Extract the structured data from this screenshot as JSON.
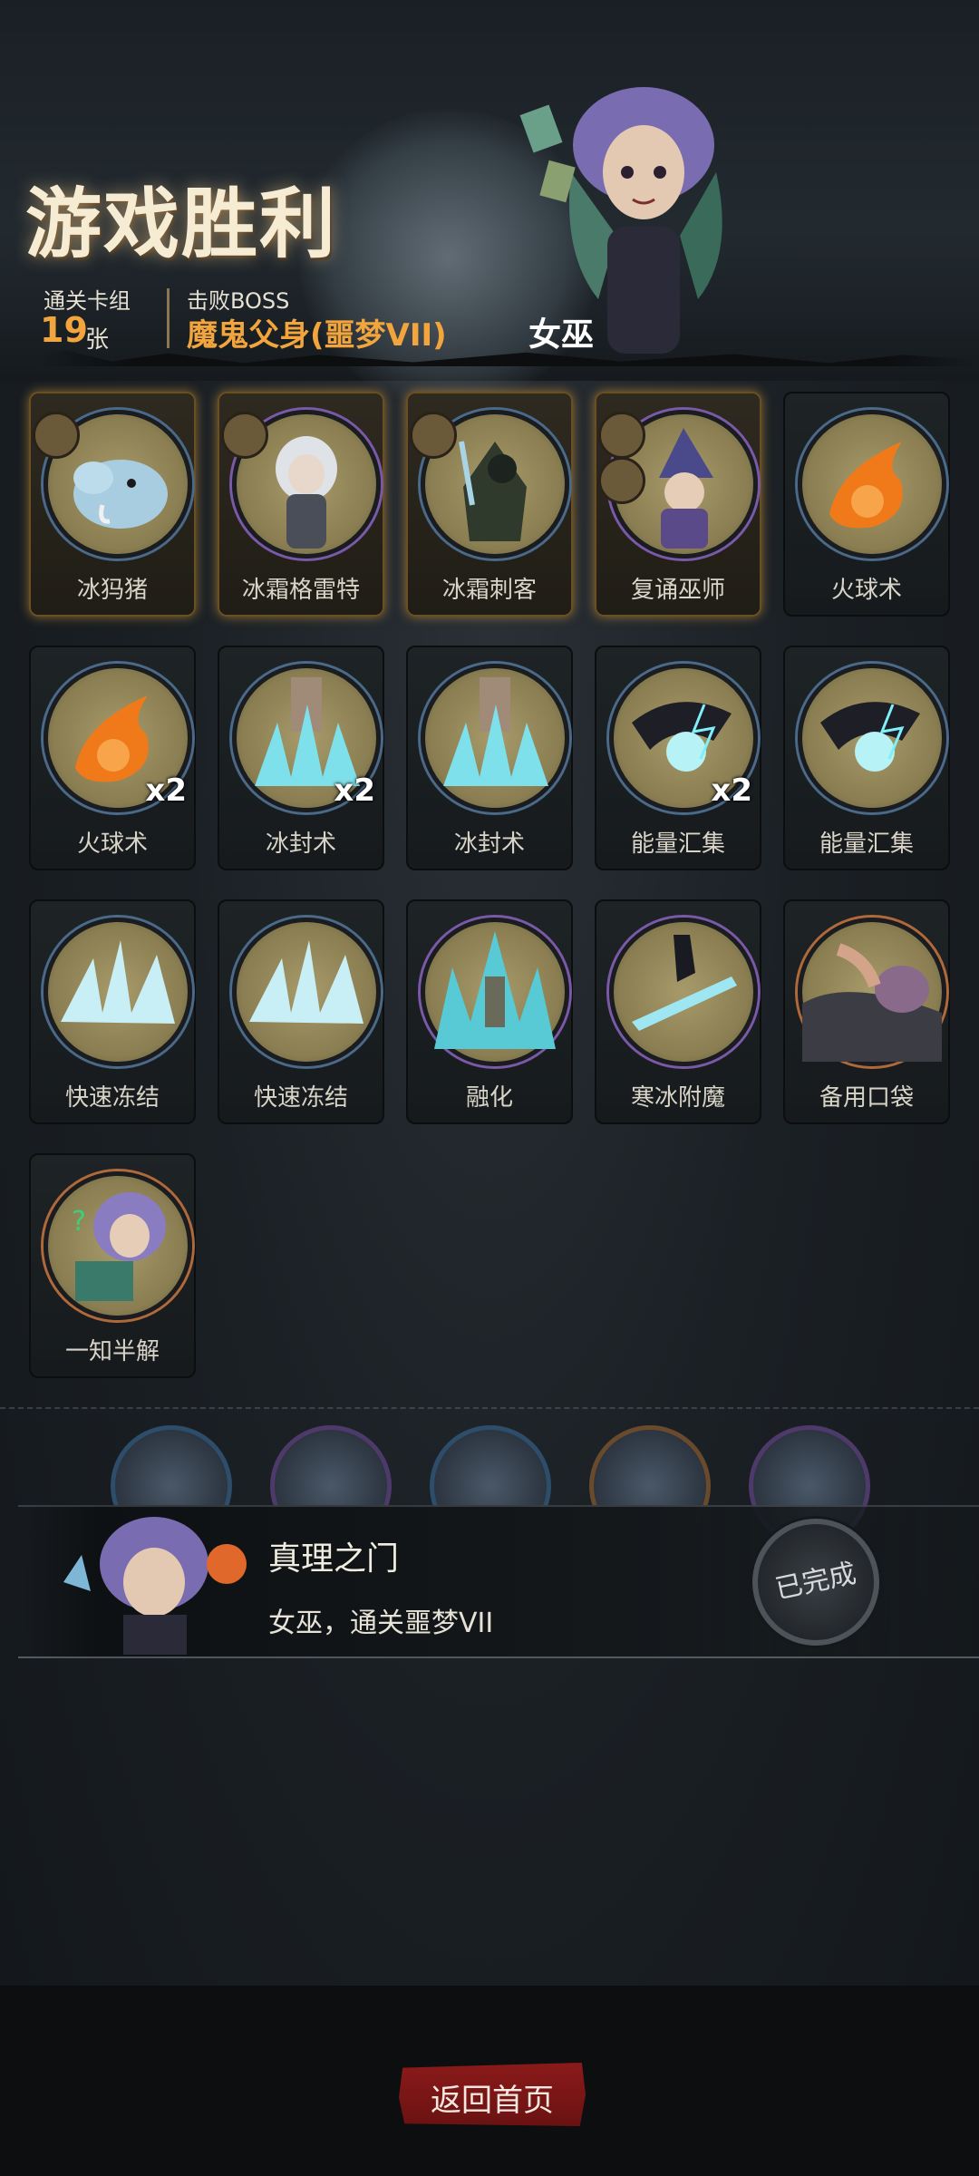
{
  "header": {
    "title": "游戏胜利",
    "stats": {
      "cards_label": "通关卡组",
      "cards_value": "19",
      "cards_unit": "张",
      "boss_label": "击败BOSS",
      "boss_value": "魔鬼父身(噩梦VII)"
    },
    "class_name": "女巫"
  },
  "deck": [
    {
      "name": "冰犸猪",
      "multiplier": "",
      "highlight": true
    },
    {
      "name": "冰霜格雷特",
      "multiplier": "",
      "highlight": true
    },
    {
      "name": "冰霜刺客",
      "multiplier": "",
      "highlight": true
    },
    {
      "name": "复诵巫师",
      "multiplier": "",
      "highlight": true
    },
    {
      "name": "火球术",
      "multiplier": "",
      "highlight": false
    },
    {
      "name": "火球术",
      "multiplier": "x2",
      "highlight": false
    },
    {
      "name": "冰封术",
      "multiplier": "x2",
      "highlight": false
    },
    {
      "name": "冰封术",
      "multiplier": "",
      "highlight": false
    },
    {
      "name": "能量汇集",
      "multiplier": "x2",
      "highlight": false
    },
    {
      "name": "能量汇集",
      "multiplier": "",
      "highlight": false
    },
    {
      "name": "快速冻结",
      "multiplier": "",
      "highlight": false
    },
    {
      "name": "快速冻结",
      "multiplier": "",
      "highlight": false
    },
    {
      "name": "融化",
      "multiplier": "",
      "highlight": false
    },
    {
      "name": "寒冰附魔",
      "multiplier": "",
      "highlight": false
    },
    {
      "name": "备用口袋",
      "multiplier": "",
      "highlight": false
    },
    {
      "name": "一知半解",
      "multiplier": "",
      "highlight": false
    }
  ],
  "relics": [
    {
      "icon": "hammer-icon"
    },
    {
      "icon": "warrior-icon"
    },
    {
      "icon": "old-man-icon"
    },
    {
      "icon": "ice-crystal-icon"
    },
    {
      "icon": "green-card-icon"
    }
  ],
  "achievement": {
    "title": "真理之门",
    "desc": "女巫，通关噩梦VII",
    "status": "已完成"
  },
  "footer": {
    "home_label": "返回首页"
  },
  "colors": {
    "accent_gold": "#f2a53c",
    "button_red": "#8b1a1a"
  }
}
